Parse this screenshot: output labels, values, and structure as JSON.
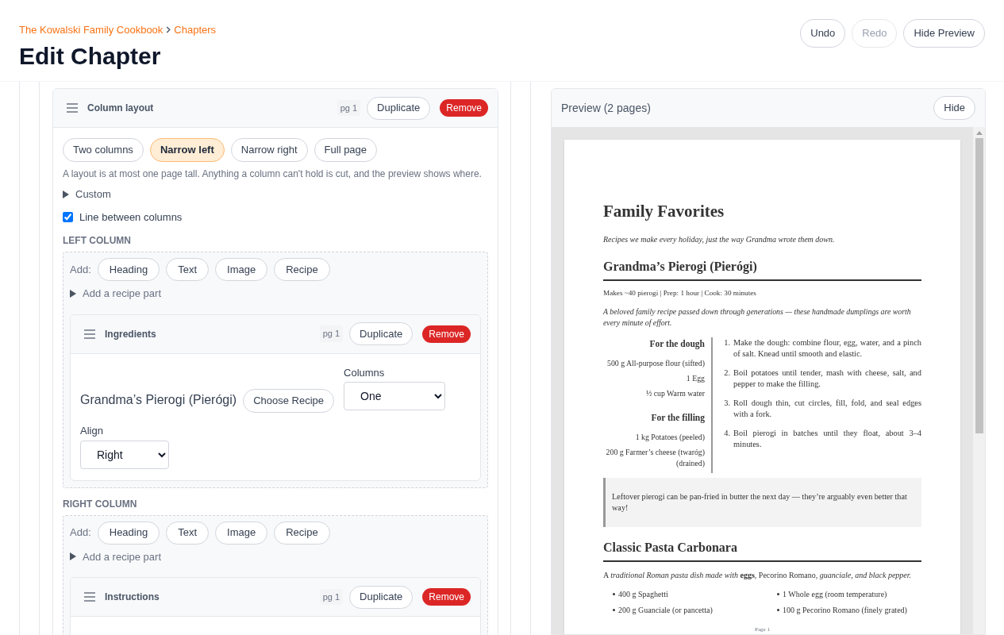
{
  "header": {
    "breadcrumb": [
      {
        "label": "The Kowalski Family Cookbook"
      },
      {
        "label": "Chapters"
      }
    ],
    "title": "Edit Chapter",
    "actions": [
      {
        "label": "Undo",
        "disabled": false
      },
      {
        "label": "Redo",
        "disabled": true
      },
      {
        "label": "Hide Preview",
        "disabled": false
      }
    ]
  },
  "editor": {
    "block": {
      "title": "Column layout",
      "page_badge": "pg 1",
      "duplicate": "Duplicate",
      "remove": "Remove",
      "layouts": [
        {
          "label": "Two columns",
          "selected": false
        },
        {
          "label": "Narrow left",
          "selected": true
        },
        {
          "label": "Narrow right",
          "selected": false
        },
        {
          "label": "Full page",
          "selected": false
        }
      ],
      "help": "A layout is at most one page tall. Anything a column can't hold is cut, and the preview shows where.",
      "custom": {
        "label": "Custom",
        "expanded": false
      },
      "line_option": {
        "label": "Line between columns",
        "checked": true
      },
      "columns": [
        {
          "label": "LEFT COLUMN",
          "add_label": "Add:",
          "add_buttons": [
            "Heading",
            "Text",
            "Image",
            "Recipe"
          ],
          "recipe_part": {
            "label": "Add a recipe part",
            "expanded": false
          },
          "blocks": [
            {
              "title": "Ingredients",
              "page_badge": "pg 1",
              "duplicate": "Duplicate",
              "remove": "Remove",
              "recipe_name": "Grandma’s Pierogi (Pierógi)",
              "choose_button": "Choose Recipe",
              "fields": [
                {
                  "label": "Columns",
                  "value": "One"
                },
                {
                  "label": "Align",
                  "value": "Right"
                }
              ]
            }
          ]
        },
        {
          "label": "RIGHT COLUMN",
          "add_label": "Add:",
          "add_buttons": [
            "Heading",
            "Text",
            "Image",
            "Recipe"
          ],
          "recipe_part": {
            "label": "Add a recipe part",
            "expanded": false
          },
          "blocks": [
            {
              "title": "Instructions",
              "page_badge": "pg 1",
              "duplicate": "Duplicate",
              "remove": "Remove"
            }
          ]
        }
      ]
    }
  },
  "preview": {
    "title": "Preview (2 pages)",
    "hide_button": "Hide",
    "page": {
      "heading": "Family Favorites",
      "intro": "Recipes we make every holiday, just the way Grandma wrote them down.",
      "recipes": [
        {
          "title": "Grandma’s Pierogi (Pierógi)",
          "meta": "Makes ~40 pierogi | Prep: 1 hour | Cook: 30 minutes",
          "description": "A beloved family recipe passed down through generations — these handmade dumplings are worth every minute of effort.",
          "ingredient_groups": [
            {
              "title": "For the dough",
              "items": [
                "500 g All-purpose flour (sifted)",
                "1 Egg",
                "½ cup Warm water"
              ]
            },
            {
              "title": "For the filling",
              "items": [
                "1 kg Potatoes (peeled)",
                "200 g Farmer’s cheese (twaróg) (drained)"
              ]
            }
          ],
          "steps": [
            {
              "number": "1.",
              "text": "Make the dough: combine flour, egg, water, and a pinch of salt. Knead until smooth and elastic."
            },
            {
              "number": "2.",
              "text": "Boil potatoes until tender, mash with cheese, salt, and pepper to make the filling."
            },
            {
              "number": "3.",
              "text": "Roll dough thin, cut circles, fill, fold, and seal edges with a fork."
            },
            {
              "number": "4.",
              "text": "Boil pierogi in batches until they float, about 3–4 minutes."
            }
          ],
          "note": "Leftover pierogi can be pan-fried in butter the next day — they’re arguably even better that way!"
        },
        {
          "title": "Classic Pasta Carbonara",
          "rich_description": "A *traditional Roman pasta dish made with* **eggs**, Pecorino Romano, *guanciale, and black pepper.*",
          "ingredients": [
            "400 g Spaghetti",
            "1 Whole egg (room temperature)",
            "200 g Guanciale (or pancetta)",
            "100 g Pecorino Romano (finely grated)"
          ]
        }
      ],
      "footer": "Page 1"
    }
  }
}
